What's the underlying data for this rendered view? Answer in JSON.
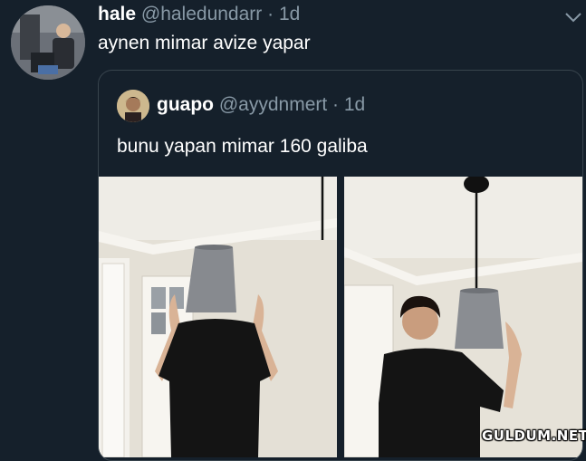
{
  "tweet": {
    "name": "hale",
    "handle": "@haledundarr",
    "separator": " · ",
    "time": "1d",
    "text": "aynen mimar avize yapar"
  },
  "quoted_tweet": {
    "name": "guapo",
    "handle": "@ayydnmert",
    "separator": " · ",
    "time": "1d",
    "text": "bunu yapan mimar 160 galiba"
  },
  "watermark": "GULDUM.NET",
  "icons": {
    "menu": "chevron-down-icon"
  },
  "colors": {
    "background": "#15202b",
    "secondary_text": "#8899a6",
    "border": "#38444d"
  }
}
